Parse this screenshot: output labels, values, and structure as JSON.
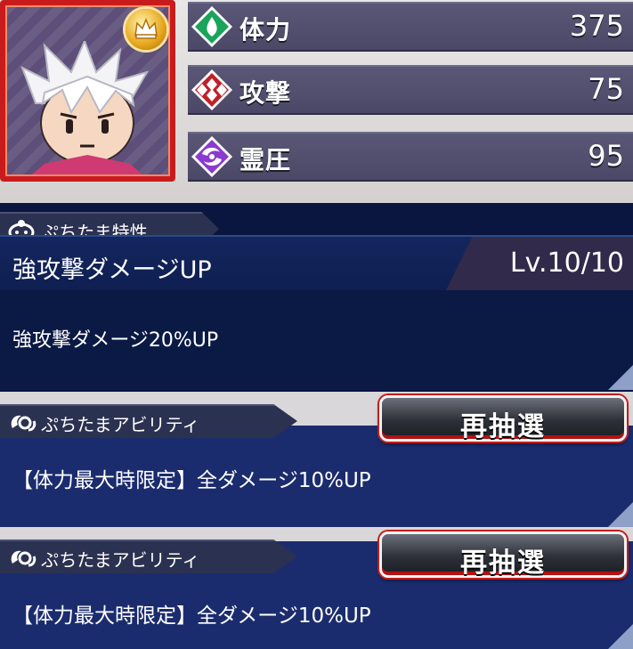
{
  "character": {
    "portrait_icon": "chibi-character-portrait",
    "badge_icon": "crown-icon"
  },
  "stats": [
    {
      "label": "体力",
      "value": "375",
      "icon": "hp-icon",
      "color": "#1aa35a"
    },
    {
      "label": "攻撃",
      "value": "75",
      "icon": "attack-icon",
      "color": "#c0202a"
    },
    {
      "label": "霊圧",
      "value": "95",
      "icon": "reiatsu-icon",
      "color": "#8a3ad0"
    }
  ],
  "trait": {
    "tab_label": "ぷちたま特性",
    "name": "強攻撃ダメージUP",
    "level": "Lv.10/10",
    "description": "強攻撃ダメージ20%UP"
  },
  "abilities": [
    {
      "tab_label": "ぷちたまアビリティ",
      "button_label": "再抽選",
      "text": "【体力最大時限定】全ダメージ10%UP"
    },
    {
      "tab_label": "ぷちたまアビリティ",
      "button_label": "再抽選",
      "text": "【体力最大時限定】全ダメージ10%UP"
    }
  ]
}
